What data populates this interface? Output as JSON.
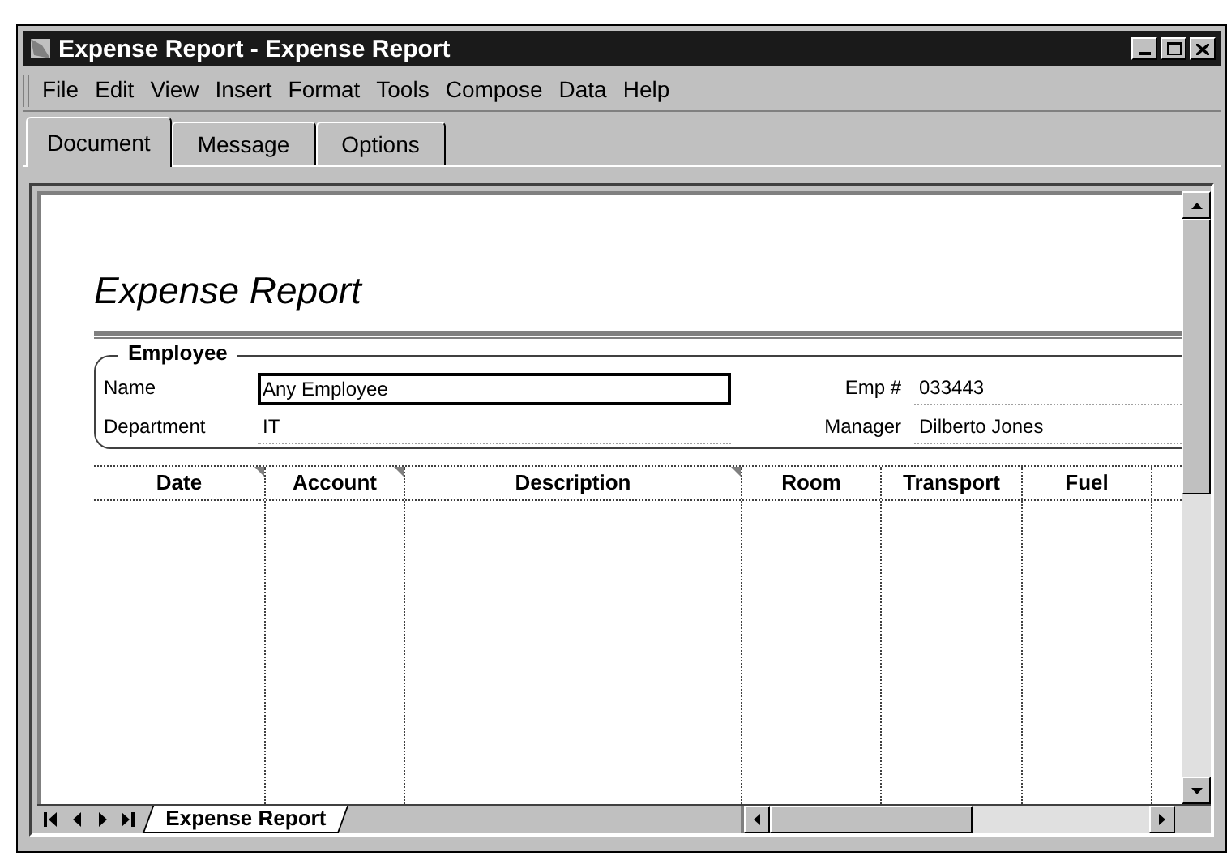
{
  "window": {
    "title": "Expense Report - Expense Report"
  },
  "menu": [
    "File",
    "Edit",
    "View",
    "Insert",
    "Format",
    "Tools",
    "Compose",
    "Data",
    "Help"
  ],
  "tabs": [
    {
      "label": "Document",
      "selected": true
    },
    {
      "label": "Message",
      "selected": false
    },
    {
      "label": "Options",
      "selected": false
    }
  ],
  "form": {
    "title": "Expense Report",
    "section": "Employee",
    "fields": [
      {
        "label": "Name",
        "value": "Any Employee",
        "focused": true
      },
      {
        "label": "Emp #",
        "value": "033443",
        "focused": false
      },
      {
        "label": "Department",
        "value": "IT",
        "focused": false
      },
      {
        "label": "Manager",
        "value": "Dilberto Jones",
        "focused": false
      }
    ]
  },
  "table": {
    "columns": [
      {
        "label": "Date",
        "marker": true
      },
      {
        "label": "Account",
        "marker": true
      },
      {
        "label": "Description",
        "marker": true
      },
      {
        "label": "Room",
        "marker": false
      },
      {
        "label": "Transport",
        "marker": false
      },
      {
        "label": "Fuel",
        "marker": false
      }
    ]
  },
  "sheet_tabs": [
    {
      "label": "Expense Report",
      "selected": true
    }
  ]
}
